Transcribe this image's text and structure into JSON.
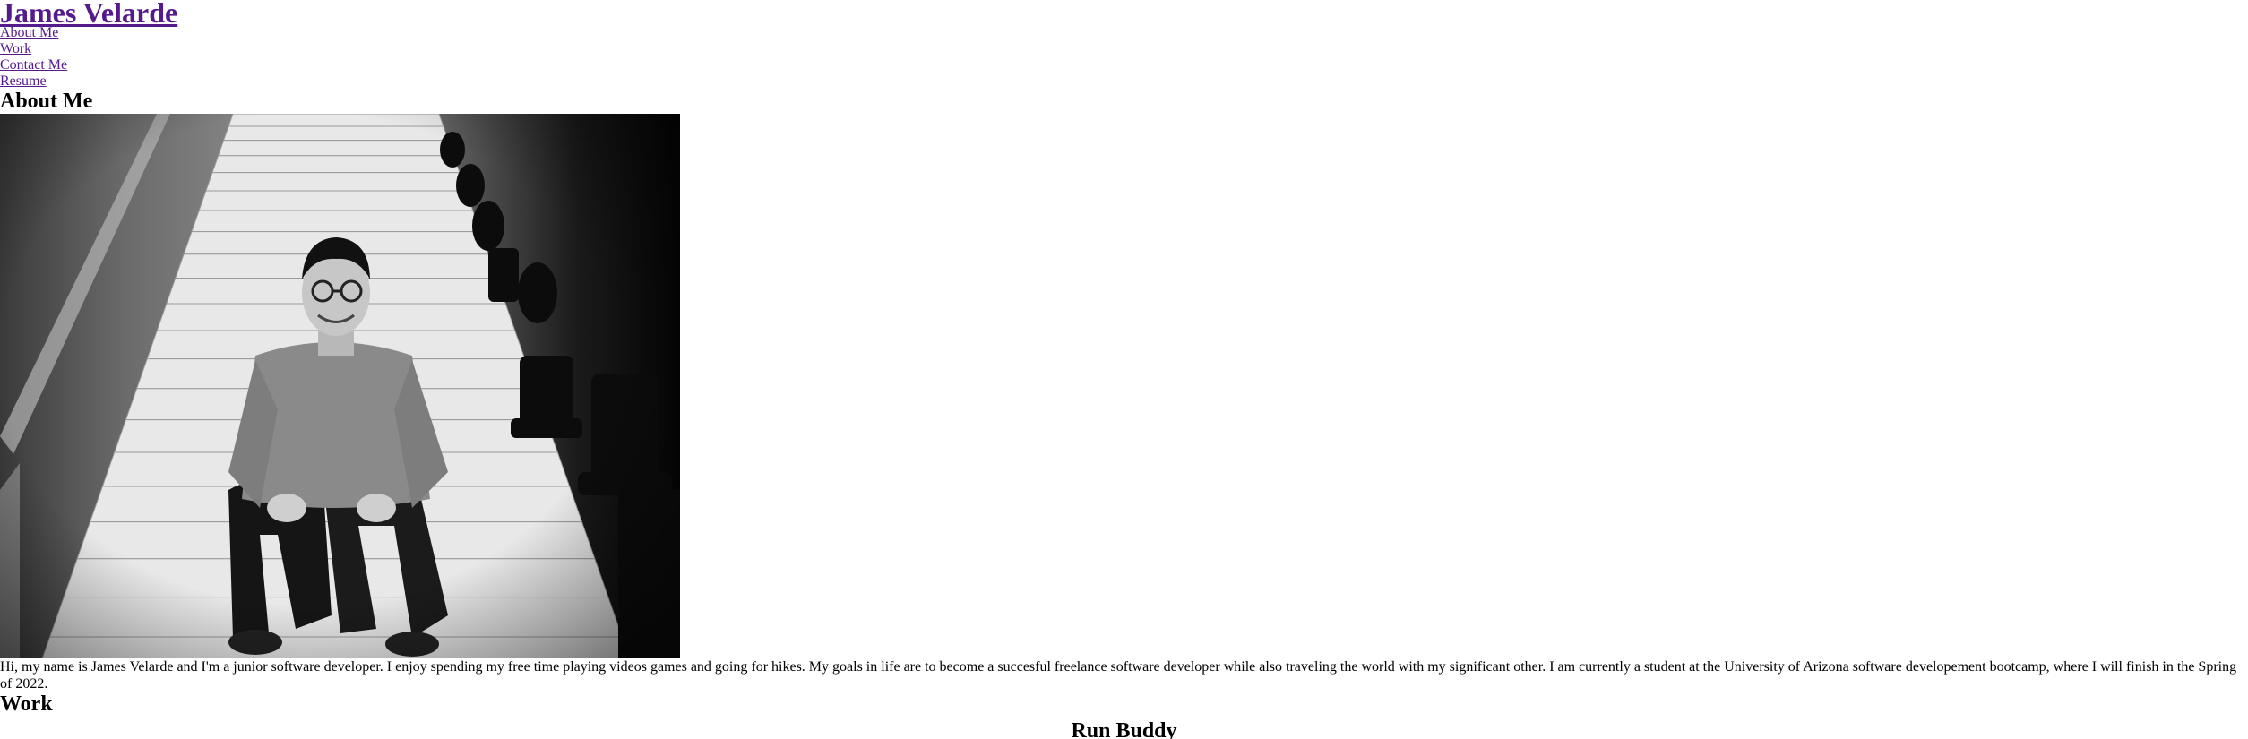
{
  "header": {
    "title": "James Velarde"
  },
  "nav": {
    "items": [
      {
        "label": "About Me"
      },
      {
        "label": "Work"
      },
      {
        "label": "Contact Me"
      },
      {
        "label": "Resume"
      }
    ]
  },
  "about": {
    "heading": "About Me",
    "photo_subject": "portrait-photo",
    "bio": "Hi, my name is James Velarde and I'm a junior software developer. I enjoy spending my free time playing videos games and going for hikes. My goals in life are to become a succesful freelance software developer while also traveling the world with my significant other. I am currently a student at the University of Arizona software developement bootcamp, where I will finish in the Spring of 2022."
  },
  "work": {
    "heading": "Work",
    "projects": [
      {
        "title": "Run Buddy"
      }
    ]
  }
}
